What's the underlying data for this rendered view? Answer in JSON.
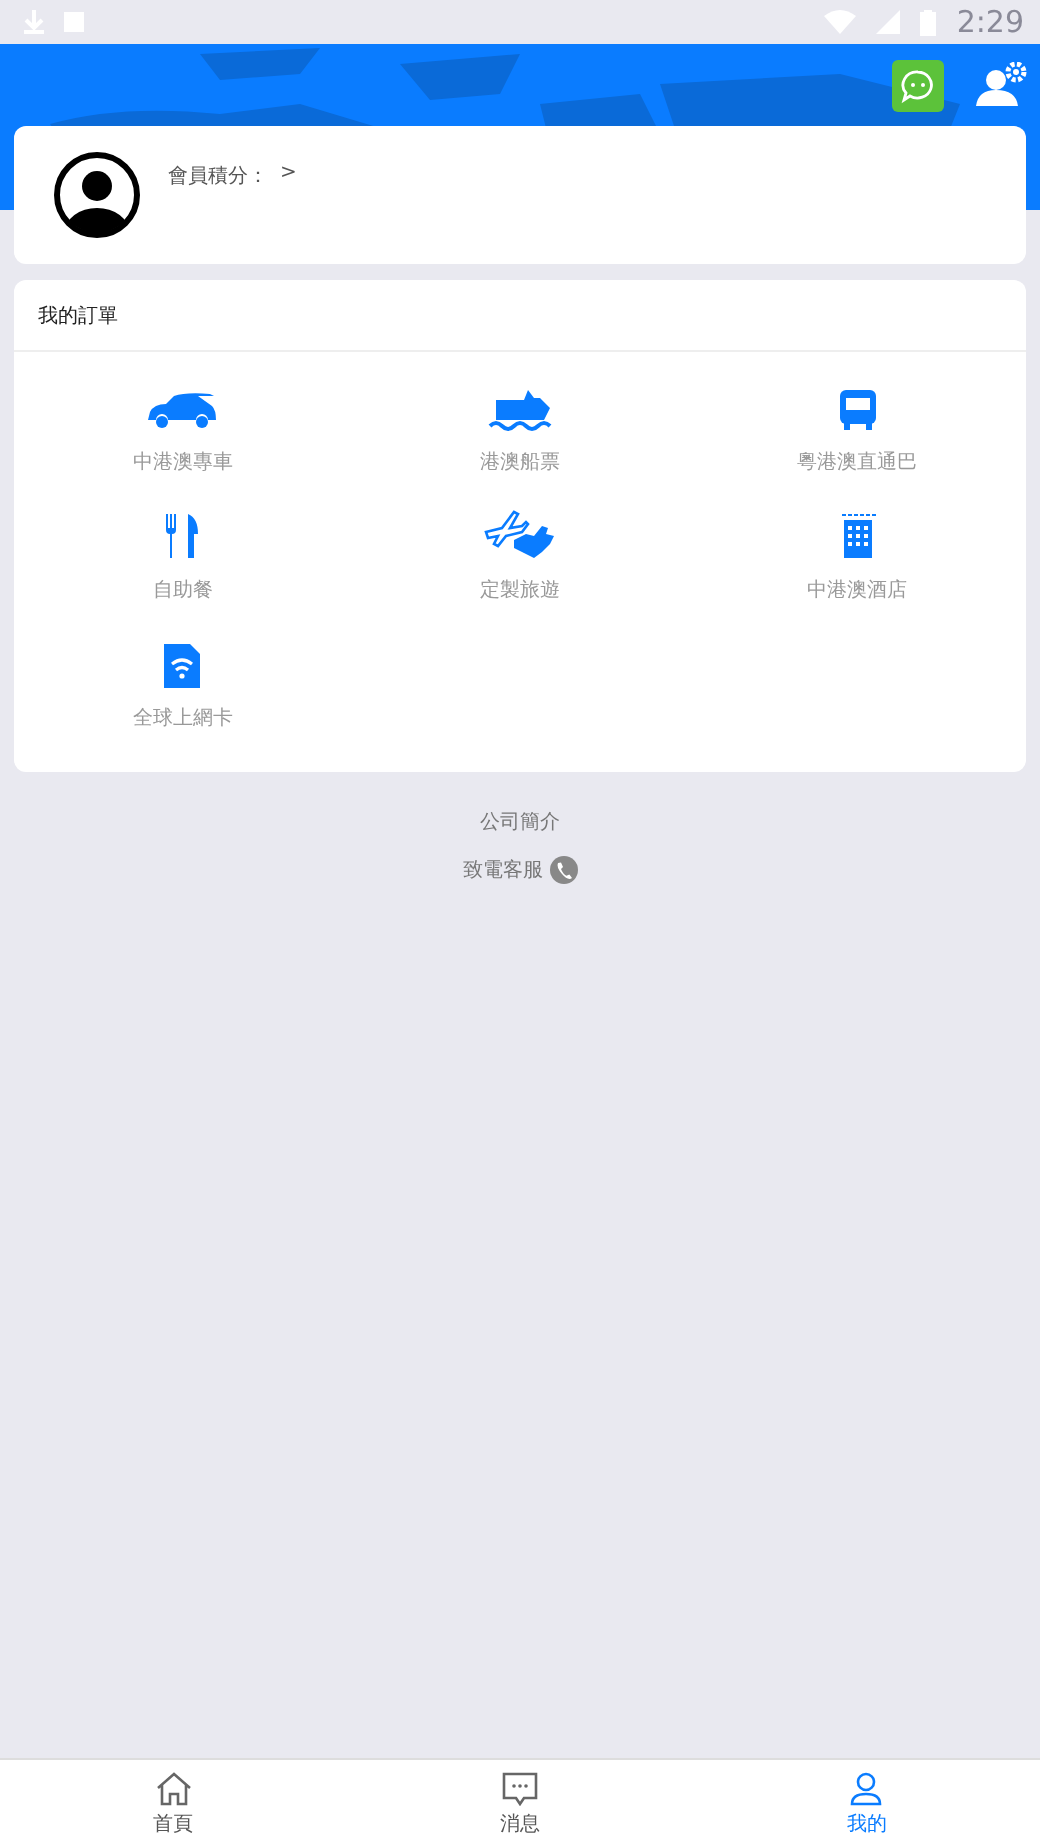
{
  "status_bar": {
    "time": "2:29"
  },
  "member": {
    "points_label": "會員積分：",
    "chevron": ">"
  },
  "orders": {
    "title": "我的訂單",
    "items": [
      {
        "kind": "car",
        "label": "中港澳專車"
      },
      {
        "kind": "ship",
        "label": "港澳船票"
      },
      {
        "kind": "bus",
        "label": "粵港澳直通巴"
      },
      {
        "kind": "cutlery",
        "label": "自助餐"
      },
      {
        "kind": "tour",
        "label": "定製旅遊"
      },
      {
        "kind": "hotel",
        "label": "中港澳酒店"
      },
      {
        "kind": "sim",
        "label": "全球上網卡"
      }
    ]
  },
  "links": [
    {
      "kind": "plain",
      "label": "公司簡介"
    },
    {
      "kind": "phone",
      "label": "致電客服"
    }
  ],
  "tabs": [
    {
      "kind": "home",
      "label": "首頁",
      "selected": false
    },
    {
      "kind": "message",
      "label": "消息",
      "selected": false
    },
    {
      "kind": "me",
      "label": "我的",
      "selected": true
    }
  ]
}
